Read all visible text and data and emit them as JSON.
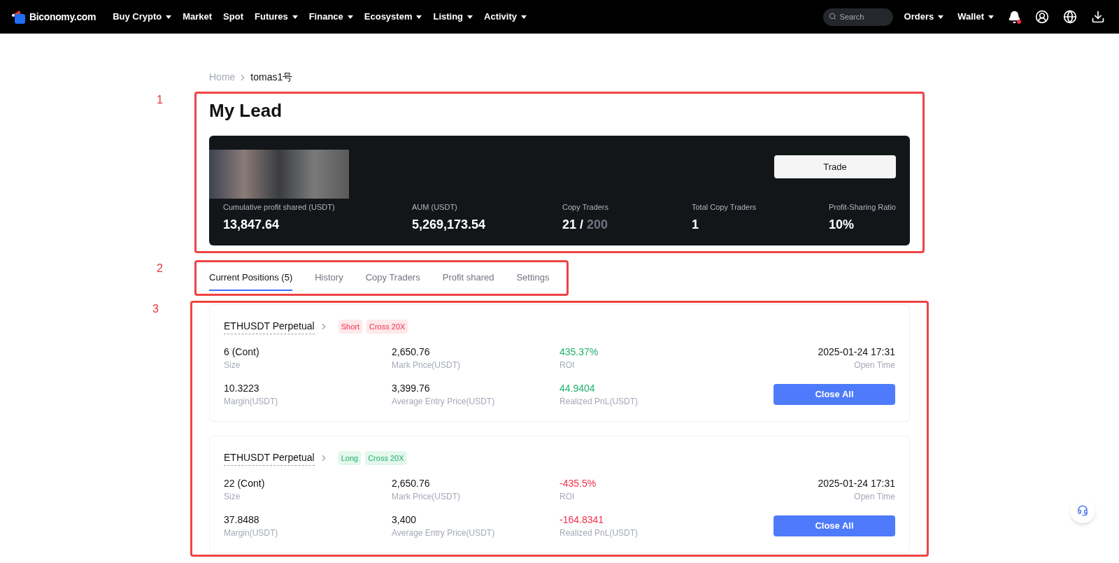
{
  "nav": {
    "logo": "Biconomy.com",
    "menu": [
      {
        "label": "Buy Crypto",
        "dropdown": true
      },
      {
        "label": "Market",
        "dropdown": false
      },
      {
        "label": "Spot",
        "dropdown": false
      },
      {
        "label": "Futures",
        "dropdown": true
      },
      {
        "label": "Finance",
        "dropdown": true
      },
      {
        "label": "Ecosystem",
        "dropdown": true
      },
      {
        "label": "Listing",
        "dropdown": true
      },
      {
        "label": "Activity",
        "dropdown": true
      }
    ],
    "search": {
      "placeholder": "Search"
    },
    "right_menu": [
      {
        "label": "Orders",
        "dropdown": true
      },
      {
        "label": "Wallet",
        "dropdown": true
      }
    ],
    "notification_dot": true
  },
  "breadcrumb": [
    "Home",
    "tomas1号"
  ],
  "annotations": [
    "1",
    "2",
    "3"
  ],
  "title": "My Lead",
  "profile": {
    "trade_button": "Trade",
    "stats": [
      {
        "label": "Cumulative profit shared (USDT)",
        "value": "13,847.64"
      },
      {
        "label": "AUM (USDT)",
        "value": "5,269,173.54"
      },
      {
        "label": "Copy Traders",
        "value": "21 / ",
        "value_muted": "200"
      },
      {
        "label": "Total Copy Traders",
        "value": "1"
      },
      {
        "label": "Profit-Sharing Ratio",
        "value": "10%"
      }
    ]
  },
  "tabs": [
    {
      "label": "Current Positions (5)",
      "selected": true
    },
    {
      "label": "History",
      "selected": false
    },
    {
      "label": "Copy Traders",
      "selected": false
    },
    {
      "label": "Profit shared",
      "selected": false
    },
    {
      "label": "Settings",
      "selected": false
    }
  ],
  "positions": [
    {
      "symbol": "ETHUSDT Perpetual",
      "side": {
        "label": "Short",
        "kind": "short"
      },
      "mode": "Cross 20X",
      "fields": [
        {
          "value": "6 (Cont)",
          "label": "Size",
          "kind": "plain"
        },
        {
          "value": "2,650.76",
          "label": "Mark Price(USDT)",
          "kind": "plain"
        },
        {
          "value": "435.37%",
          "label": "ROI",
          "kind": "gain"
        },
        {
          "value": "2025-01-24 17:31",
          "label": "Open Time",
          "kind": "plain"
        },
        {
          "value": "10.3223",
          "label": "Margin(USDT)",
          "kind": "plain"
        },
        {
          "value": "3,399.76",
          "label": "Average Entry Price(USDT)",
          "kind": "plain"
        },
        {
          "value": "44.9404",
          "label": "Realized PnL(USDT)",
          "kind": "gain"
        }
      ],
      "button": "Close All"
    },
    {
      "symbol": "ETHUSDT Perpetual",
      "side": {
        "label": "Long",
        "kind": "long"
      },
      "mode": "Cross 20X",
      "fields": [
        {
          "value": "22 (Cont)",
          "label": "Size",
          "kind": "plain"
        },
        {
          "value": "2,650.76",
          "label": "Mark Price(USDT)",
          "kind": "plain"
        },
        {
          "value": "-435.5%",
          "label": "ROI",
          "kind": "loss"
        },
        {
          "value": "2025-01-24 17:31",
          "label": "Open Time",
          "kind": "plain"
        },
        {
          "value": "37.8488",
          "label": "Margin(USDT)",
          "kind": "plain"
        },
        {
          "value": "3,400",
          "label": "Average Entry Price(USDT)",
          "kind": "plain"
        },
        {
          "value": "-164.8341",
          "label": "Realized PnL(USDT)",
          "kind": "loss"
        }
      ],
      "button": "Close All"
    }
  ]
}
